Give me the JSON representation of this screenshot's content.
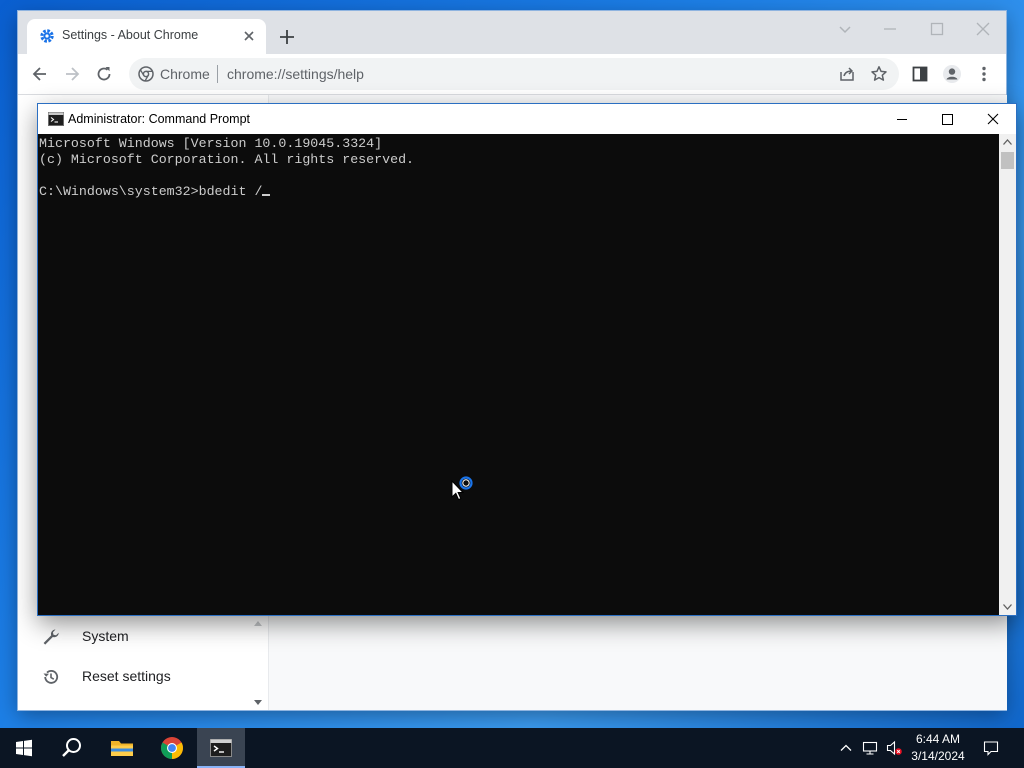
{
  "browser": {
    "tab_title": "Settings - About Chrome",
    "omnibox_chip": "Chrome",
    "url": "chrome://settings/help",
    "sidebar_items": [
      {
        "label": "System",
        "icon": "wrench-icon"
      },
      {
        "label": "Reset settings",
        "icon": "reset-history-icon"
      }
    ]
  },
  "cmd": {
    "title": "Administrator: Command Prompt",
    "lines": [
      "Microsoft Windows [Version 10.0.19045.3324]",
      "(c) Microsoft Corporation. All rights reserved.",
      "",
      "C:\\Windows\\system32>bdedit /"
    ]
  },
  "taskbar": {
    "items": [
      "start-icon",
      "search-icon",
      "file-explorer-icon",
      "chrome-icon",
      "command-prompt-icon"
    ],
    "active_item": "command-prompt-icon",
    "time": "6:44 AM",
    "date": "3/14/2024"
  },
  "colors": {
    "desktop": "#1d7fe6",
    "console_bg": "#0c0c0c",
    "console_fg": "#cccccc",
    "taskbar": "#0b1523",
    "chrome_accent": "#1a73e8"
  }
}
